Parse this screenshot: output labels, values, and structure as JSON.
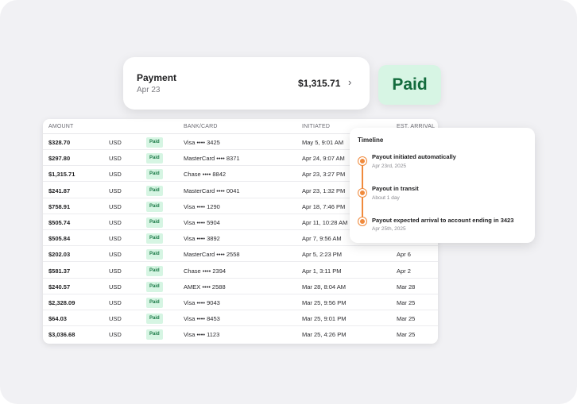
{
  "payment": {
    "title": "Payment",
    "date": "Apr 23",
    "amount": "$1,315.71",
    "chevron": "›"
  },
  "status_badge": "Paid",
  "table": {
    "headers": {
      "amount": "AMOUNT",
      "bank": "BANK/CARD",
      "initiated": "INITIATED",
      "eta": "EST. ARRIVAL"
    },
    "rows": [
      {
        "amount": "$328.70",
        "currency": "USD",
        "status": "Paid",
        "bank": "Visa •••• 3425",
        "initiated": "May 5, 9:01 AM",
        "eta": ""
      },
      {
        "amount": "$297.80",
        "currency": "USD",
        "status": "Paid",
        "bank": "MasterCard •••• 8371",
        "initiated": "Apr 24, 9:07 AM",
        "eta": ""
      },
      {
        "amount": "$1,315.71",
        "currency": "USD",
        "status": "Paid",
        "bank": "Chase •••• 8842",
        "initiated": "Apr 23, 3:27 PM",
        "eta": ""
      },
      {
        "amount": "$241.87",
        "currency": "USD",
        "status": "Paid",
        "bank": "MasterCard •••• 0041",
        "initiated": "Apr 23, 1:32 PM",
        "eta": ""
      },
      {
        "amount": "$758.91",
        "currency": "USD",
        "status": "Paid",
        "bank": "Visa •••• 1290",
        "initiated": "Apr 18, 7:46 PM",
        "eta": ""
      },
      {
        "amount": "$505.74",
        "currency": "USD",
        "status": "Paid",
        "bank": "Visa •••• 5904",
        "initiated": "Apr 11, 10:28 AM",
        "eta": ""
      },
      {
        "amount": "$505.84",
        "currency": "USD",
        "status": "Paid",
        "bank": "Visa •••• 3892",
        "initiated": "Apr 7, 9:56 AM",
        "eta": ""
      },
      {
        "amount": "$202.03",
        "currency": "USD",
        "status": "Paid",
        "bank": "MasterCard •••• 2558",
        "initiated": "Apr 5, 2:23 PM",
        "eta": "Apr 6"
      },
      {
        "amount": "$581.37",
        "currency": "USD",
        "status": "Paid",
        "bank": "Chase •••• 2394",
        "initiated": "Apr 1, 3:11 PM",
        "eta": "Apr 2"
      },
      {
        "amount": "$240.57",
        "currency": "USD",
        "status": "Paid",
        "bank": "AMEX •••• 2588",
        "initiated": "Mar 28, 8:04 AM",
        "eta": "Mar 28"
      },
      {
        "amount": "$2,328.09",
        "currency": "USD",
        "status": "Paid",
        "bank": "Visa •••• 9043",
        "initiated": "Mar 25, 9:56 PM",
        "eta": "Mar 25"
      },
      {
        "amount": "$64.03",
        "currency": "USD",
        "status": "Paid",
        "bank": "Visa •••• 8453",
        "initiated": "Mar 25, 9:01 PM",
        "eta": "Mar 25"
      },
      {
        "amount": "$3,036.68",
        "currency": "USD",
        "status": "Paid",
        "bank": "Visa •••• 1123",
        "initiated": "Mar 25, 4:26 PM",
        "eta": "Mar 25"
      }
    ]
  },
  "timeline": {
    "title": "Timeline",
    "events": [
      {
        "title": "Payout initiated automatically",
        "sub": "Apr 23rd, 2025"
      },
      {
        "title": "Payout in transit",
        "sub": "About 1 day"
      },
      {
        "title": "Payout expected arrival to account ending in 3423",
        "sub": "Apr 25th, 2025"
      }
    ]
  },
  "colors": {
    "accent_orange": "#f08a3c",
    "paid_green_bg": "#d7f5e4",
    "paid_green_text": "#136c3d"
  }
}
